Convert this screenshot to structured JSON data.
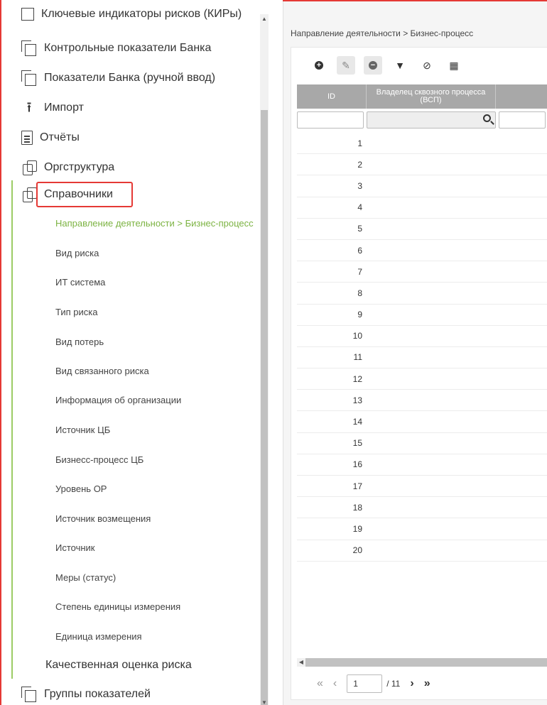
{
  "sidebar": {
    "items": [
      {
        "label": "Ключевые индикаторы рисков (КИРы)",
        "icon": "checkbox-icon"
      },
      {
        "label": "Контрольные показатели Банка",
        "icon": "copy-icon"
      },
      {
        "label": "Показатели Банка (ручной ввод)",
        "icon": "copy-icon"
      },
      {
        "label": "Импорт",
        "icon": "upload-icon"
      },
      {
        "label": "Отчёты",
        "icon": "document-icon"
      },
      {
        "label": "Оргструктура",
        "icon": "org-icon"
      },
      {
        "label": "Справочники",
        "icon": "org-icon"
      }
    ],
    "subitems": [
      "Направление деятельности > Бизнес-процесс",
      "Вид риска",
      "ИТ система",
      "Тип риска",
      "Вид потерь",
      "Вид связанного риска",
      "Информация об организации",
      "Источник ЦБ",
      "Бизнесс-процесс ЦБ",
      "Уровень ОР",
      "Источник возмещения",
      "Источник",
      "Меры (статус)",
      "Степень единицы измерения",
      "Единица измерения"
    ],
    "bottom_items": [
      {
        "label": "Качественная оценка риска"
      },
      {
        "label": "Группы показателей",
        "icon": "copy-icon"
      }
    ]
  },
  "main": {
    "breadcrumb": "Направление деятельности > Бизнес-процесс",
    "table": {
      "columns": [
        "ID",
        "Владелец сквозного процесса (ВСП)"
      ],
      "rows": [
        "1",
        "2",
        "3",
        "4",
        "5",
        "6",
        "7",
        "8",
        "9",
        "10",
        "11",
        "12",
        "13",
        "14",
        "15",
        "16",
        "17",
        "18",
        "19",
        "20"
      ]
    },
    "pager": {
      "page": "1",
      "total": "/ 11"
    }
  },
  "colors": {
    "accent_green": "#7cb342",
    "highlight_red": "#e53935",
    "header_grey": "#a8a8a8"
  }
}
